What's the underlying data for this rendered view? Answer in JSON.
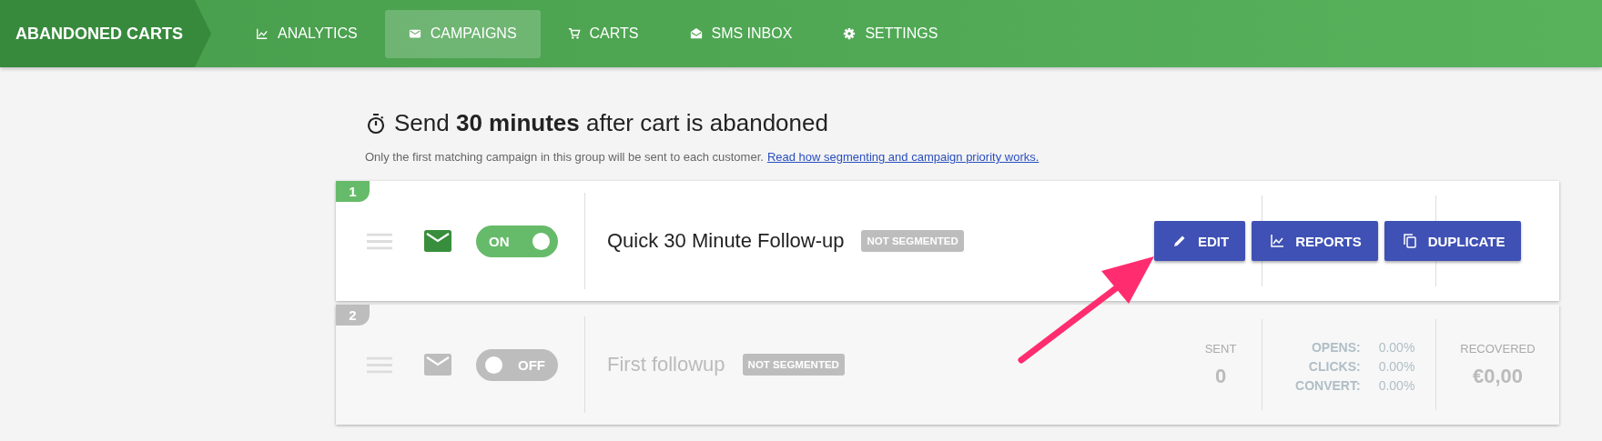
{
  "nav": {
    "brand": "ABANDONED CARTS",
    "items": [
      {
        "label": "ANALYTICS",
        "selected": false
      },
      {
        "label": "CAMPAIGNS",
        "selected": true
      },
      {
        "label": "CARTS",
        "selected": false
      },
      {
        "label": "SMS INBOX",
        "selected": false
      },
      {
        "label": "SETTINGS",
        "selected": false
      }
    ]
  },
  "header": {
    "title": "Send **30 minutes** after cart is abandoned",
    "note": "Only the first matching campaign in this group will be sent to each customer.",
    "link": "Read how segmenting and campaign priority works."
  },
  "campaigns": [
    {
      "number": "1",
      "on": true,
      "toggle_label": "ON",
      "name": "Quick 30 Minute Follow-up",
      "tag": "NOT SEGMENTED",
      "actions": [
        "EDIT",
        "REPORTS",
        "DUPLICATE"
      ]
    },
    {
      "number": "2",
      "on": false,
      "toggle_label": "OFF",
      "name": "First followup",
      "tag": "NOT SEGMENTED",
      "stats": {
        "sent_label": "SENT",
        "sent": "0",
        "rates": [
          {
            "label": "OPENS:",
            "value": "0.00%"
          },
          {
            "label": "CLICKS:",
            "value": "0.00%"
          },
          {
            "label": "CONVERT:",
            "value": "0.00%"
          }
        ],
        "recovered_label": "RECOVERED",
        "recovered": "€0,00"
      }
    }
  ]
}
